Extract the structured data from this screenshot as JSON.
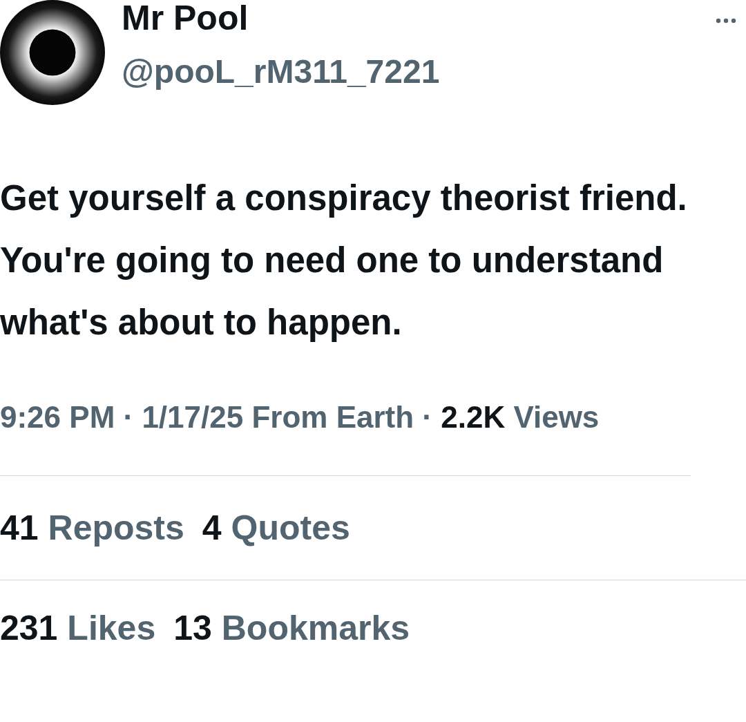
{
  "author": {
    "name": "Mr Pool",
    "handle": "@pooL_rM311_7221"
  },
  "post": {
    "text": "Get yourself a conspiracy theorist friend. You're going to need one to understand what's about to happen."
  },
  "meta": "9:26 PM · 1/17/25 From Earth · **2.2K** Views",
  "stat_rows": [
    [
      {
        "count": "41",
        "label": "Reposts"
      },
      {
        "count": "4",
        "label": "Quotes"
      }
    ],
    [
      {
        "count": "231",
        "label": "Likes"
      },
      {
        "count": "13",
        "label": "Bookmarks"
      }
    ]
  ]
}
